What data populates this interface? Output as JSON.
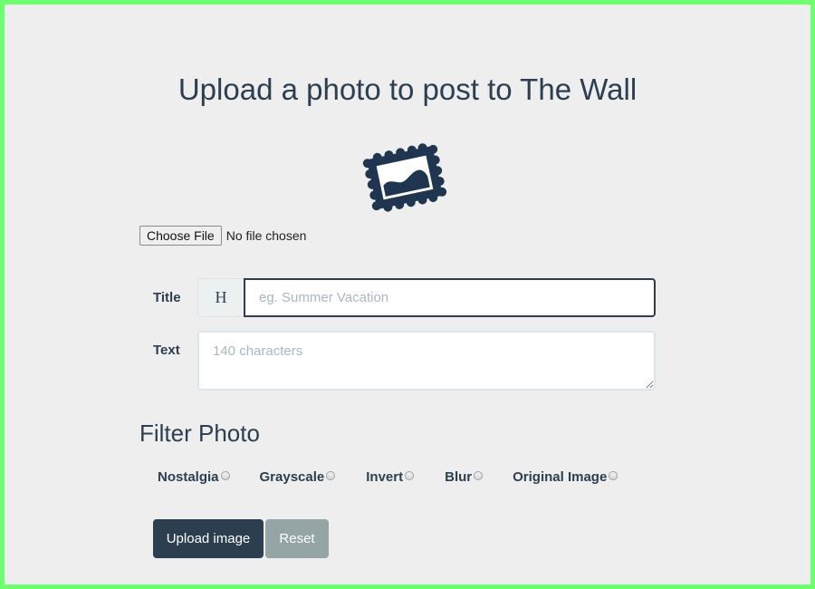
{
  "page": {
    "heading": "Upload a photo to post to The Wall"
  },
  "icons": {
    "photo": "framed-photo-icon",
    "title_addon": "H"
  },
  "file_input": {
    "button_label": "Choose File",
    "status": "No file chosen"
  },
  "form": {
    "title_label": "Title",
    "title_placeholder": "eg. Summer Vacation",
    "title_value": "",
    "text_label": "Text",
    "text_placeholder": "140 characters",
    "text_value": ""
  },
  "filters": {
    "heading": "Filter Photo",
    "options": [
      {
        "label": "Nostalgia",
        "selected": false
      },
      {
        "label": "Grayscale",
        "selected": false
      },
      {
        "label": "Invert",
        "selected": false
      },
      {
        "label": "Blur",
        "selected": false
      },
      {
        "label": "Original Image",
        "selected": false
      }
    ]
  },
  "actions": {
    "upload_label": "Upload image",
    "reset_label": "Reset"
  },
  "colors": {
    "primary": "#2c3e50",
    "secondary": "#95a5a6",
    "page_background": "#eeeeee",
    "frame_border": "#6dff6d"
  }
}
